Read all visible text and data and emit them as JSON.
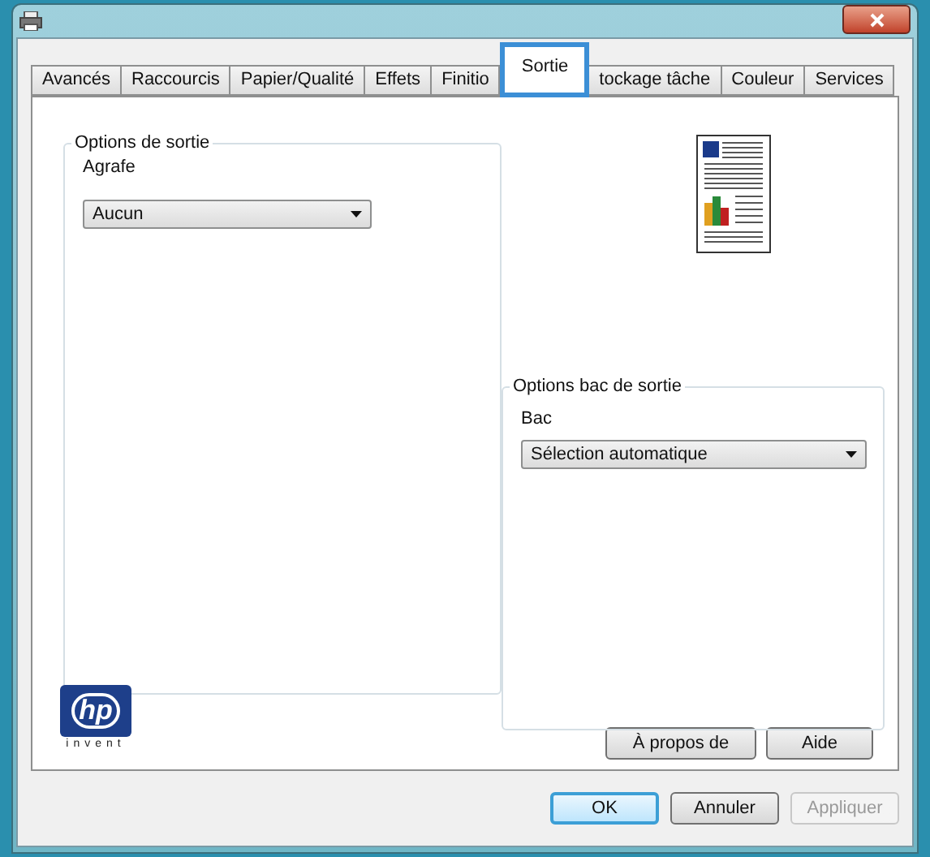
{
  "tabs": [
    {
      "label": "Avancés",
      "selected": false
    },
    {
      "label": "Raccourcis",
      "selected": false
    },
    {
      "label": "Papier/Qualité",
      "selected": false
    },
    {
      "label": "Effets",
      "selected": false
    },
    {
      "label": "Finitio",
      "selected": false
    },
    {
      "label": "Sortie",
      "selected": true
    },
    {
      "label": "tockage tâche",
      "selected": false
    },
    {
      "label": "Couleur",
      "selected": false
    },
    {
      "label": "Services",
      "selected": false
    }
  ],
  "output_options": {
    "legend": "Options de sortie",
    "label": "Agrafe",
    "value": "Aucun"
  },
  "output_tray_options": {
    "legend": "Options bac de sortie",
    "label": "Bac",
    "value": "Sélection automatique"
  },
  "logo": {
    "mark": "hp",
    "tagline": "invent"
  },
  "panel_buttons": [
    {
      "label": "À propos de",
      "disabled": false
    },
    {
      "label": "Aide",
      "disabled": false
    }
  ],
  "dialog_buttons": [
    {
      "label": "OK",
      "disabled": false,
      "default": true
    },
    {
      "label": "Annuler",
      "disabled": false,
      "default": false
    },
    {
      "label": "Appliquer",
      "disabled": true,
      "default": false
    }
  ]
}
